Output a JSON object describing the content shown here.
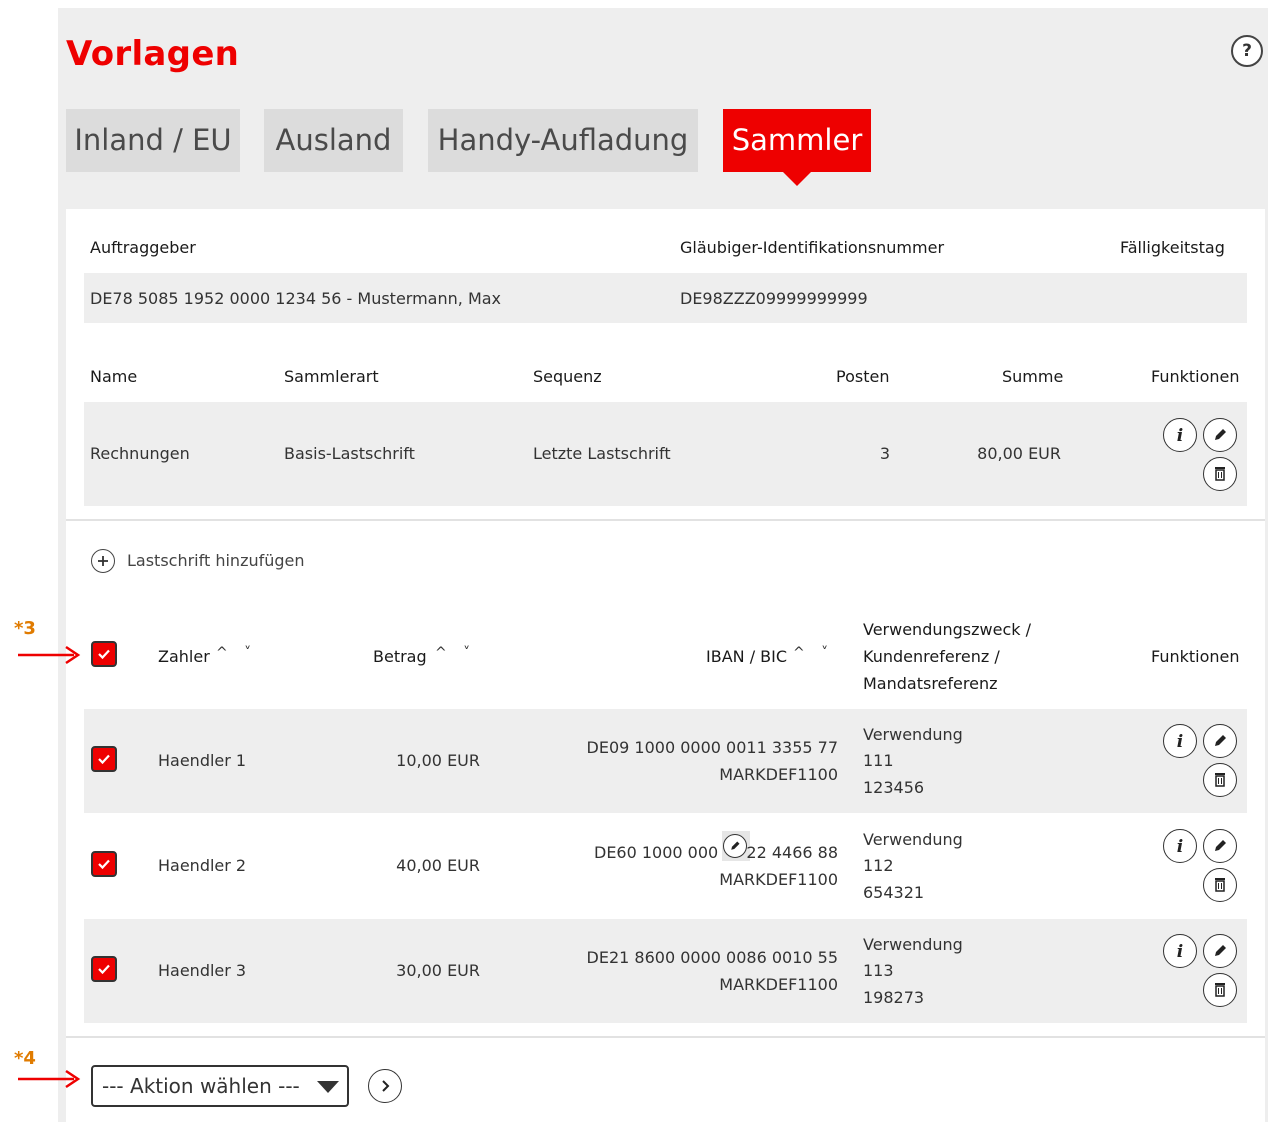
{
  "page": {
    "title": "Vorlagen",
    "help_label": "?"
  },
  "tabs": [
    {
      "label": "Inland / EU"
    },
    {
      "label": "Ausland"
    },
    {
      "label": "Handy-Aufladung"
    },
    {
      "label": "Sammler"
    }
  ],
  "active_tab": "Sammler",
  "account": {
    "headers": {
      "auftraggeber": "Auftraggeber",
      "glaeubiger_id": "Gläubiger-Identifikationsnummer",
      "faelligkeitstag": "Fälligkeitstag"
    },
    "auftraggeber": "DE78 5085 1952 0000 1234 56 - Mustermann, Max",
    "glaeubiger_id": "DE98ZZZ09999999999",
    "faelligkeitstag": ""
  },
  "collector": {
    "headers": {
      "name": "Name",
      "art": "Sammlerart",
      "sequenz": "Sequenz",
      "posten": "Posten",
      "summe": "Summe",
      "funktionen": "Funktionen"
    },
    "row": {
      "name": "Rechnungen",
      "art": "Basis-Lastschrift",
      "sequenz": "Letzte Lastschrift",
      "posten": "3",
      "summe": "80,00 EUR"
    }
  },
  "add_debit_label": "Lastschrift hinzufügen",
  "debits": {
    "headers": {
      "zahler": "Zahler",
      "betrag": "Betrag",
      "iban_bic": "IBAN / BIC",
      "verwendung_1": "Verwendungszweck /",
      "verwendung_2": "Kundenreferenz /",
      "verwendung_3": "Mandatsreferenz",
      "funktionen": "Funktionen"
    },
    "rows": [
      {
        "zahler": "Haendler 1",
        "betrag": "10,00 EUR",
        "iban": "DE09 1000 0000 0011 3355 77",
        "bic": "MARKDEF1100",
        "zweck": "Verwendung",
        "kundenref": "111",
        "mandat": "123456",
        "checked": true
      },
      {
        "zahler": "Haendler 2",
        "betrag": "40,00 EUR",
        "iban_start": "DE60 1000 000",
        "iban_end": "22 4466 88",
        "bic": "MARKDEF1100",
        "zweck": "Verwendung",
        "kundenref": "112",
        "mandat": "654321",
        "checked": true
      },
      {
        "zahler": "Haendler 3",
        "betrag": "30,00 EUR",
        "iban": "DE21 8600 0000 0086 0010 55",
        "bic": "MARKDEF1100",
        "zweck": "Verwendung",
        "kundenref": "113",
        "mandat": "198273",
        "checked": true
      }
    ]
  },
  "action_select": {
    "selected": "--- Aktion wählen ---"
  },
  "annotations": {
    "a3": "*3",
    "a4": "*4"
  },
  "colors": {
    "accent": "#ee0000",
    "annotation": "#e07b00",
    "panel": "#eeeeee"
  }
}
